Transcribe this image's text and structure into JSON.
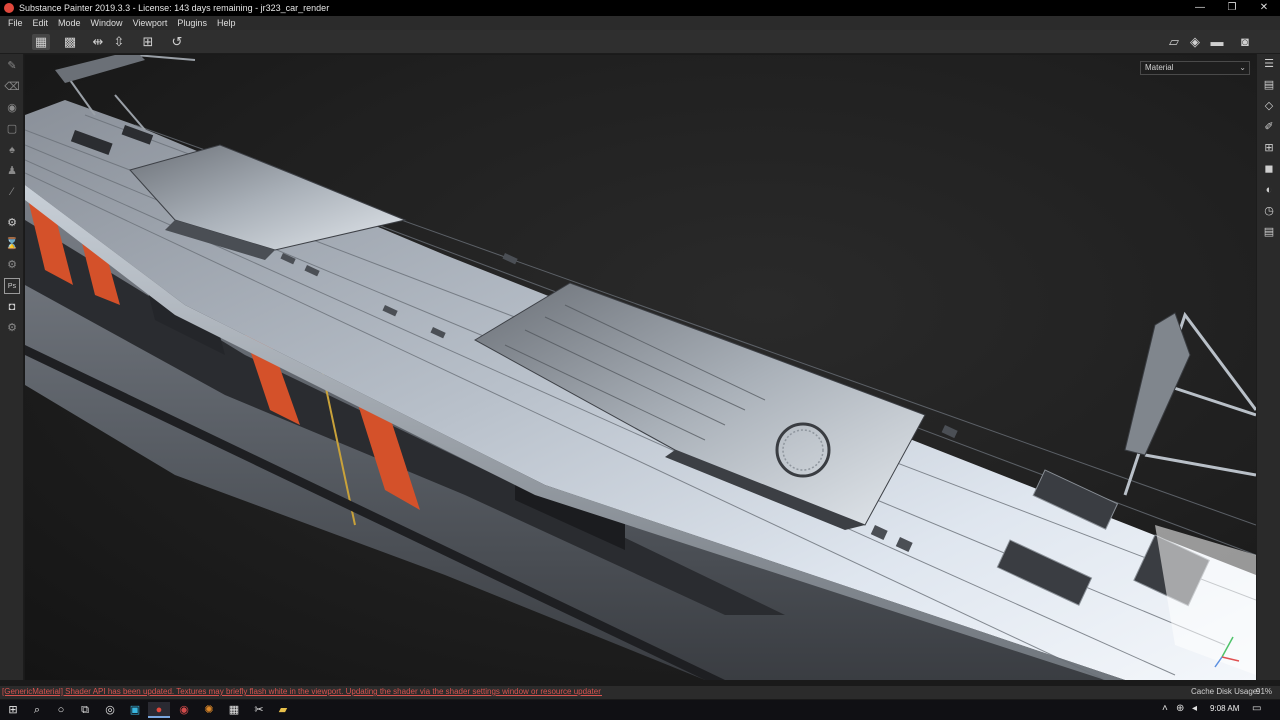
{
  "window": {
    "title": "Substance Painter 2019.3.3 - License: 143 days remaining - jr323_car_render",
    "controls": [
      "—",
      "❐",
      "✕"
    ]
  },
  "menu": [
    "File",
    "Edit",
    "Mode",
    "Window",
    "Viewport",
    "Plugins",
    "Help"
  ],
  "viewport": {
    "channel_select": "Material"
  },
  "status": {
    "message": "[GenericMaterial] Shader API has been updated. Textures may briefly flash white in the viewport. Updating the shader via the shader settings window or resource updater plugin co...",
    "cache_label": "Cache Disk Usage:",
    "cache_value": "91%"
  },
  "taskbar": {
    "time": "9:08 AM"
  },
  "icons": {
    "toolbar": [
      "grid-single-icon",
      "grid-multi-icon",
      "symmetry-x-icon",
      "symmetry-y-icon",
      "frame-icon",
      "history-icon",
      "camera-view-icon",
      "cube-view-icon",
      "video-icon",
      "screenshot-icon"
    ],
    "left": [
      "paint-brush-icon",
      "eraser-icon",
      "projection-icon",
      "polygon-fill-icon",
      "smudge-icon",
      "clone-icon",
      "color-picker-icon",
      "bake-icon",
      "export-icon",
      "iray-icon",
      "photoshop-icon",
      "shelf-icon",
      "settings-icon"
    ],
    "right": [
      "layers-panel-icon",
      "texture-set-icon",
      "layer-stack-icon",
      "properties-icon",
      "uv-icon",
      "display-icon",
      "shader-icon",
      "history-panel-icon",
      "log-icon"
    ]
  },
  "colors": {
    "accent_orange": "#d4512a",
    "status_error": "#d9534f",
    "metal_light": "#dfe6ef",
    "metal_dark": "#5a5f66"
  }
}
